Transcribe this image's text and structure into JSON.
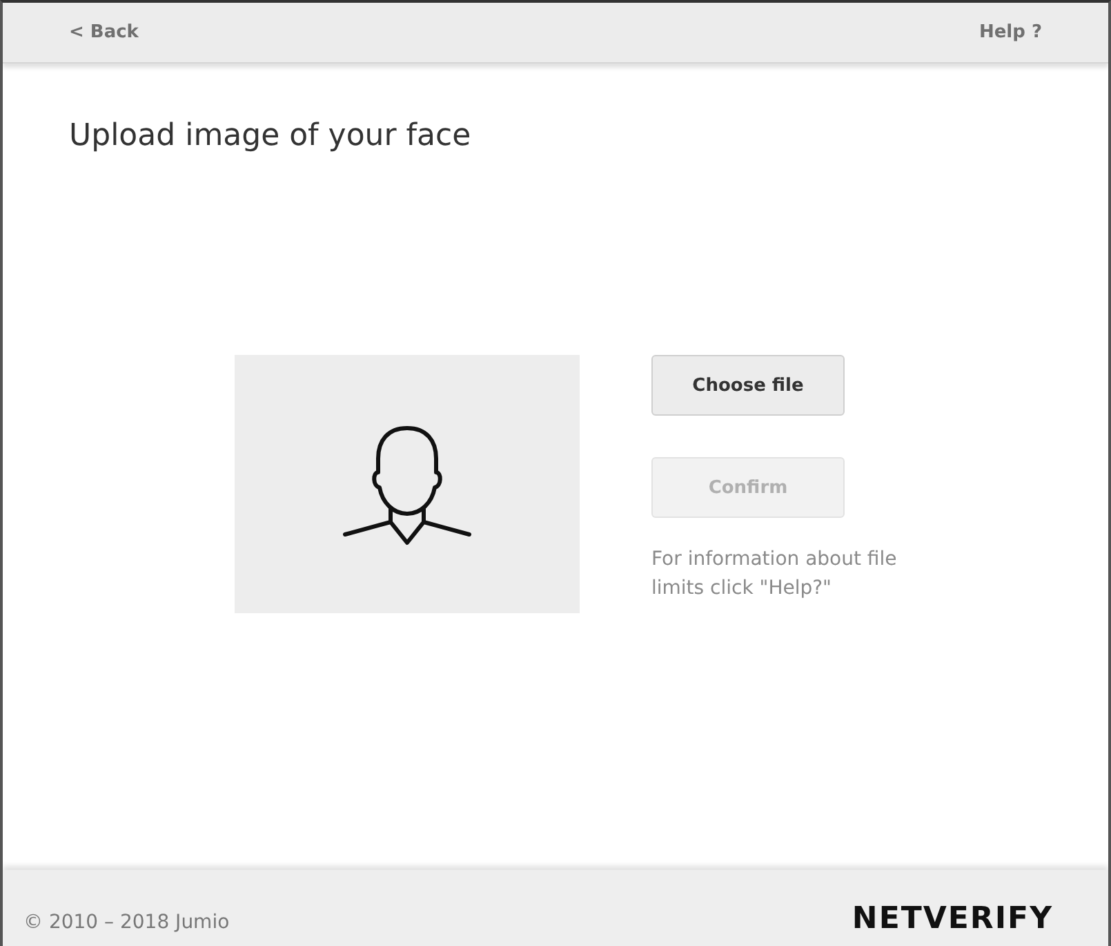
{
  "header": {
    "back": "< Back",
    "help": "Help ?"
  },
  "title": "Upload image of your face",
  "buttons": [
    {
      "label": "Choose file",
      "disabled": false
    },
    {
      "label": "Confirm",
      "disabled": true
    }
  ],
  "info": "For information about file limits click \"Help?\"",
  "footer": {
    "copyright": "© 2010 – 2018 Jumio",
    "logo": "NETVERIFY"
  }
}
